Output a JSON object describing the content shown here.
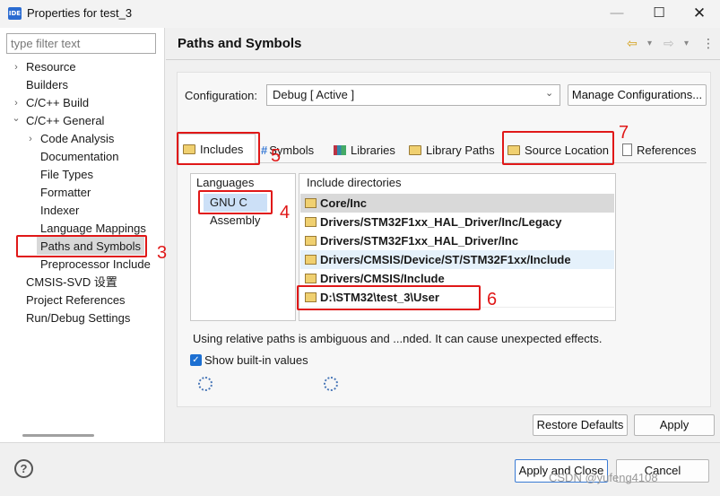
{
  "window": {
    "title": "Properties for test_3",
    "app_icon": "IDE",
    "minimize": "—",
    "maximize": "☐",
    "close": "✕"
  },
  "sidebar": {
    "filter_placeholder": "type filter text",
    "items": [
      {
        "label": "Resource",
        "arrow": "›"
      },
      {
        "label": "Builders",
        "arrow": ""
      },
      {
        "label": "C/C++ Build",
        "arrow": "›"
      },
      {
        "label": "C/C++ General",
        "arrow": "⌄"
      },
      {
        "label": "Code Analysis",
        "arrow": "›"
      },
      {
        "label": "Documentation",
        "arrow": ""
      },
      {
        "label": "File Types",
        "arrow": ""
      },
      {
        "label": "Formatter",
        "arrow": ""
      },
      {
        "label": "Indexer",
        "arrow": ""
      },
      {
        "label": "Language Mappings",
        "arrow": ""
      },
      {
        "label": "Paths and Symbols",
        "arrow": ""
      },
      {
        "label": "Preprocessor Include",
        "arrow": ""
      },
      {
        "label": "CMSIS-SVD 设置",
        "arrow": ""
      },
      {
        "label": "Project References",
        "arrow": ""
      },
      {
        "label": "Run/Debug Settings",
        "arrow": ""
      }
    ],
    "selected": "Paths and Symbols"
  },
  "main": {
    "title": "Paths and Symbols",
    "configuration_label": "Configuration:",
    "configuration_value": "Debug  [ Active ]",
    "manage_button": "Manage Configurations...",
    "tabs": [
      "Includes",
      "Symbols",
      "Libraries",
      "Library Paths",
      "Source Location",
      "References"
    ],
    "active_tab": "Includes",
    "languages_header": "Languages",
    "languages": [
      "GNU C",
      "Assembly"
    ],
    "selected_language": "GNU C",
    "include_header": "Include directories",
    "include_dirs": [
      "Core/Inc",
      "Drivers/STM32F1xx_HAL_Driver/Inc/Legacy",
      "Drivers/STM32F1xx_HAL_Driver/Inc",
      "Drivers/CMSIS/Device/ST/STM32F1xx/Include",
      "Drivers/CMSIS/Include",
      "D:\\STM32\\test_3\\User"
    ],
    "warning": "Using relative paths is ambiguous and ...nded. It can cause unexpected effects.",
    "show_builtin_label": "Show built-in values",
    "show_builtin_checked": true,
    "restore_defaults": "Restore Defaults",
    "apply": "Apply"
  },
  "footer": {
    "help": "?",
    "apply_close": "Apply and Close",
    "cancel": "Cancel"
  },
  "annotations": [
    "3",
    "4",
    "5",
    "6",
    "7"
  ],
  "watermark": "CSDN @yufeng4108",
  "colors": {
    "annotation_red": "#e01818",
    "selection_gray": "#d8d8d8",
    "accent_blue": "#1c6fd1"
  }
}
